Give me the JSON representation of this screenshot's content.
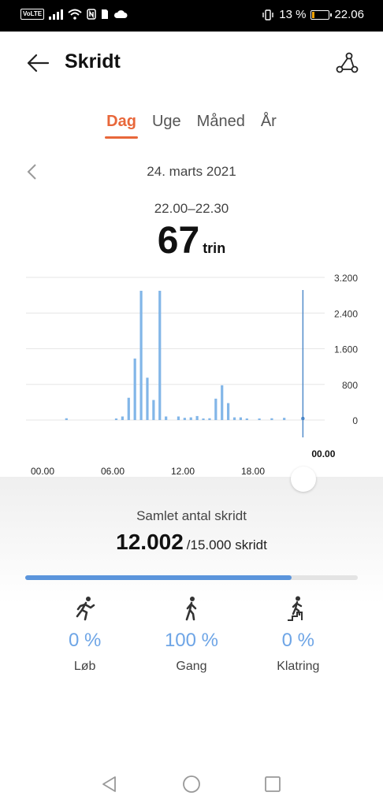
{
  "status_bar": {
    "volte": "VoLTE",
    "battery_text": "13 %",
    "battery_level": 0.13,
    "battery_color": "#f4a300",
    "time": "22.06",
    "icons": [
      "signal-icon",
      "wifi-icon",
      "nfc-icon",
      "sim-icon",
      "cloud-icon",
      "vibrate-icon",
      "battery-icon"
    ]
  },
  "header": {
    "title": "Skridt",
    "back_icon": "arrow-left-icon",
    "share_icon": "share-icon"
  },
  "tabs": [
    {
      "label": "Dag",
      "active": true
    },
    {
      "label": "Uge",
      "active": false
    },
    {
      "label": "Måned",
      "active": false
    },
    {
      "label": "År",
      "active": false
    }
  ],
  "accent_color": "#e8673a",
  "date_nav": {
    "date": "24. marts 2021",
    "prev_icon": "chevron-left-icon"
  },
  "selection": {
    "range": "22.00–22.30",
    "value": "67",
    "unit": "trin"
  },
  "chart_data": {
    "type": "bar",
    "x_ticks": [
      "00.00",
      "06.00",
      "12.00",
      "18.00",
      "00.00"
    ],
    "y_ticks": [
      "3.200",
      "2.400",
      "1.600",
      "800",
      "0"
    ],
    "ylim": [
      0,
      3200
    ],
    "bar_color": "#82b6e8",
    "selected_color": "#4a86c8",
    "selected_index": 44,
    "values": [
      0,
      0,
      0,
      0,
      0,
      0,
      40,
      0,
      0,
      0,
      0,
      0,
      0,
      0,
      30,
      80,
      500,
      1380,
      2900,
      950,
      450,
      2900,
      80,
      0,
      80,
      50,
      60,
      90,
      30,
      40,
      480,
      780,
      380,
      60,
      60,
      20,
      0,
      30,
      0,
      40,
      0,
      50,
      0,
      0,
      67,
      0,
      0,
      0
    ]
  },
  "summary": {
    "label": "Samlet antal skridt",
    "total": "12.002",
    "goal": "/15.000 skridt",
    "progress": 0.8,
    "progress_color": "#5b95dc"
  },
  "activities": [
    {
      "icon": "running-icon",
      "percent": "0 %",
      "label": "Løb"
    },
    {
      "icon": "walking-icon",
      "percent": "100 %",
      "label": "Gang"
    },
    {
      "icon": "climbing-icon",
      "percent": "0 %",
      "label": "Klatring"
    }
  ],
  "nav_bar": {
    "icons": [
      "back-triangle-icon",
      "home-circle-icon",
      "recents-square-icon"
    ]
  }
}
